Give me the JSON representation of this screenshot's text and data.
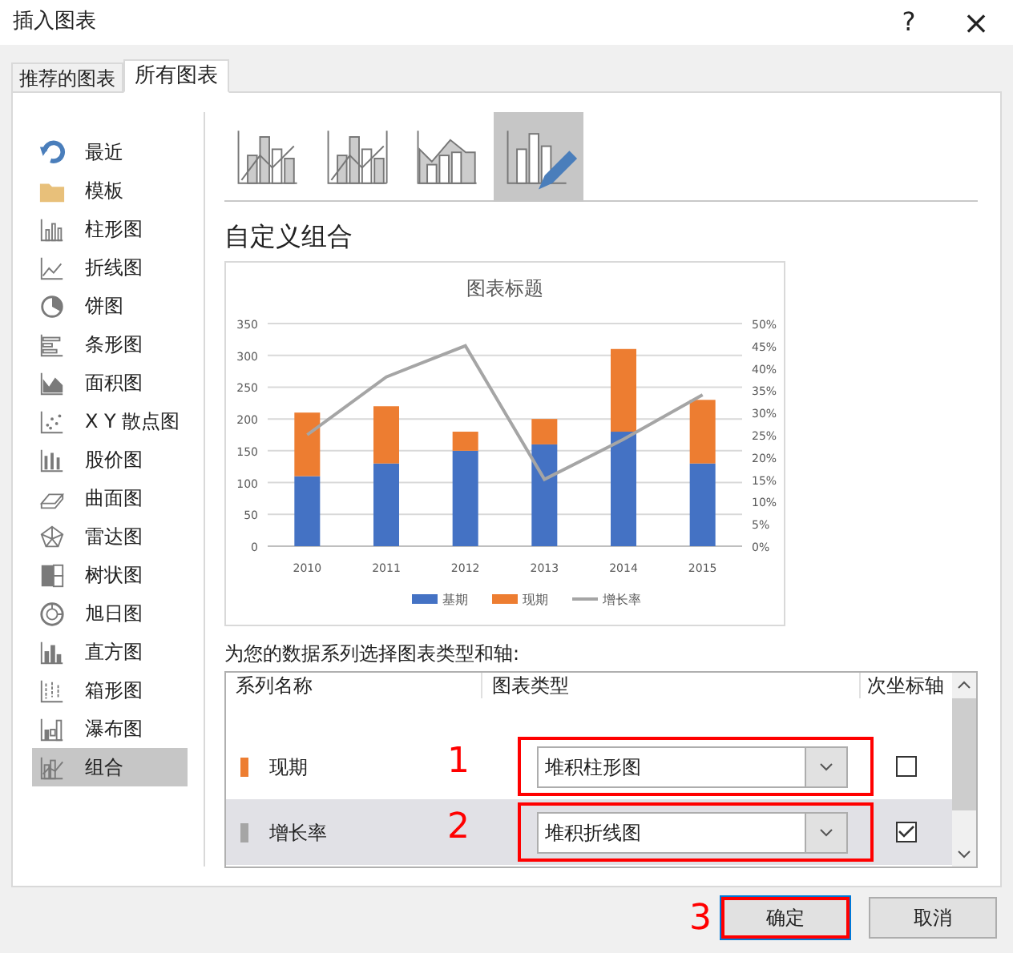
{
  "window": {
    "title": "插入图表",
    "help": "?",
    "close": "×"
  },
  "tabs": [
    {
      "label": "推荐的图表",
      "selected": false
    },
    {
      "label": "所有图表",
      "selected": true
    }
  ],
  "sidebar": {
    "items": [
      {
        "label": "最近",
        "selected": false
      },
      {
        "label": "模板",
        "selected": false
      },
      {
        "label": "柱形图",
        "selected": false
      },
      {
        "label": "折线图",
        "selected": false
      },
      {
        "label": "饼图",
        "selected": false
      },
      {
        "label": "条形图",
        "selected": false
      },
      {
        "label": "面积图",
        "selected": false
      },
      {
        "label": "X Y 散点图",
        "selected": false
      },
      {
        "label": "股价图",
        "selected": false
      },
      {
        "label": "曲面图",
        "selected": false
      },
      {
        "label": "雷达图",
        "selected": false
      },
      {
        "label": "树状图",
        "selected": false
      },
      {
        "label": "旭日图",
        "selected": false
      },
      {
        "label": "直方图",
        "selected": false
      },
      {
        "label": "箱形图",
        "selected": false
      },
      {
        "label": "瀑布图",
        "selected": false
      },
      {
        "label": "组合",
        "selected": true
      }
    ]
  },
  "subtypes": [
    {
      "selected": false
    },
    {
      "selected": false
    },
    {
      "selected": false
    },
    {
      "selected": true
    }
  ],
  "heading": "自定义组合",
  "preview": {
    "chart_data": {
      "type": "bar",
      "stacked": true,
      "grid": "y",
      "legend": "bottom",
      "title": "图表标题",
      "categories": [
        "2010",
        "2011",
        "2012",
        "2013",
        "2014",
        "2015"
      ],
      "series": [
        {
          "name": "基期",
          "color": "#4472c4",
          "values": [
            110,
            130,
            150,
            160,
            180,
            130
          ]
        },
        {
          "name": "现期",
          "color": "#ed7d31",
          "values": [
            100,
            90,
            30,
            40,
            130,
            100
          ]
        },
        {
          "name": "增长率",
          "color": "#a5a5a5",
          "type": "line",
          "axis": "y2",
          "values": [
            0.25,
            0.38,
            0.45,
            0.15,
            0.24,
            0.34
          ]
        }
      ],
      "ylim": [
        0,
        350
      ],
      "yticks": [
        0,
        50,
        100,
        150,
        200,
        250,
        300,
        350
      ],
      "y2lim": [
        0,
        0.5
      ],
      "y2ticks": [
        {
          "value": 0,
          "label": "0%"
        },
        {
          "value": 0.05,
          "label": "5%"
        },
        {
          "value": 0.1,
          "label": "10%"
        },
        {
          "value": 0.15,
          "label": "15%"
        },
        {
          "value": 0.2,
          "label": "20%"
        },
        {
          "value": 0.25,
          "label": "25%"
        },
        {
          "value": 0.3,
          "label": "30%"
        },
        {
          "value": 0.35,
          "label": "35%"
        },
        {
          "value": 0.4,
          "label": "40%"
        },
        {
          "value": 0.45,
          "label": "45%"
        },
        {
          "value": 0.5,
          "label": "50%"
        }
      ]
    }
  },
  "series_prompt": "为您的数据系列选择图表类型和轴:",
  "series_table": {
    "columns": [
      "系列名称",
      "图表类型",
      "次坐标轴"
    ],
    "rows": [
      {
        "name": "现期",
        "color": "#ed7d31",
        "chart_type": "堆积柱形图",
        "secondary_axis": false,
        "selected": false,
        "callout": "1"
      },
      {
        "name": "增长率",
        "color": "#a5a5a5",
        "chart_type": "堆积折线图",
        "secondary_axis": true,
        "selected": true,
        "callout": "2"
      }
    ]
  },
  "buttons": [
    {
      "label": "确定",
      "default": true,
      "callout": "3"
    },
    {
      "label": "取消",
      "default": false
    }
  ]
}
